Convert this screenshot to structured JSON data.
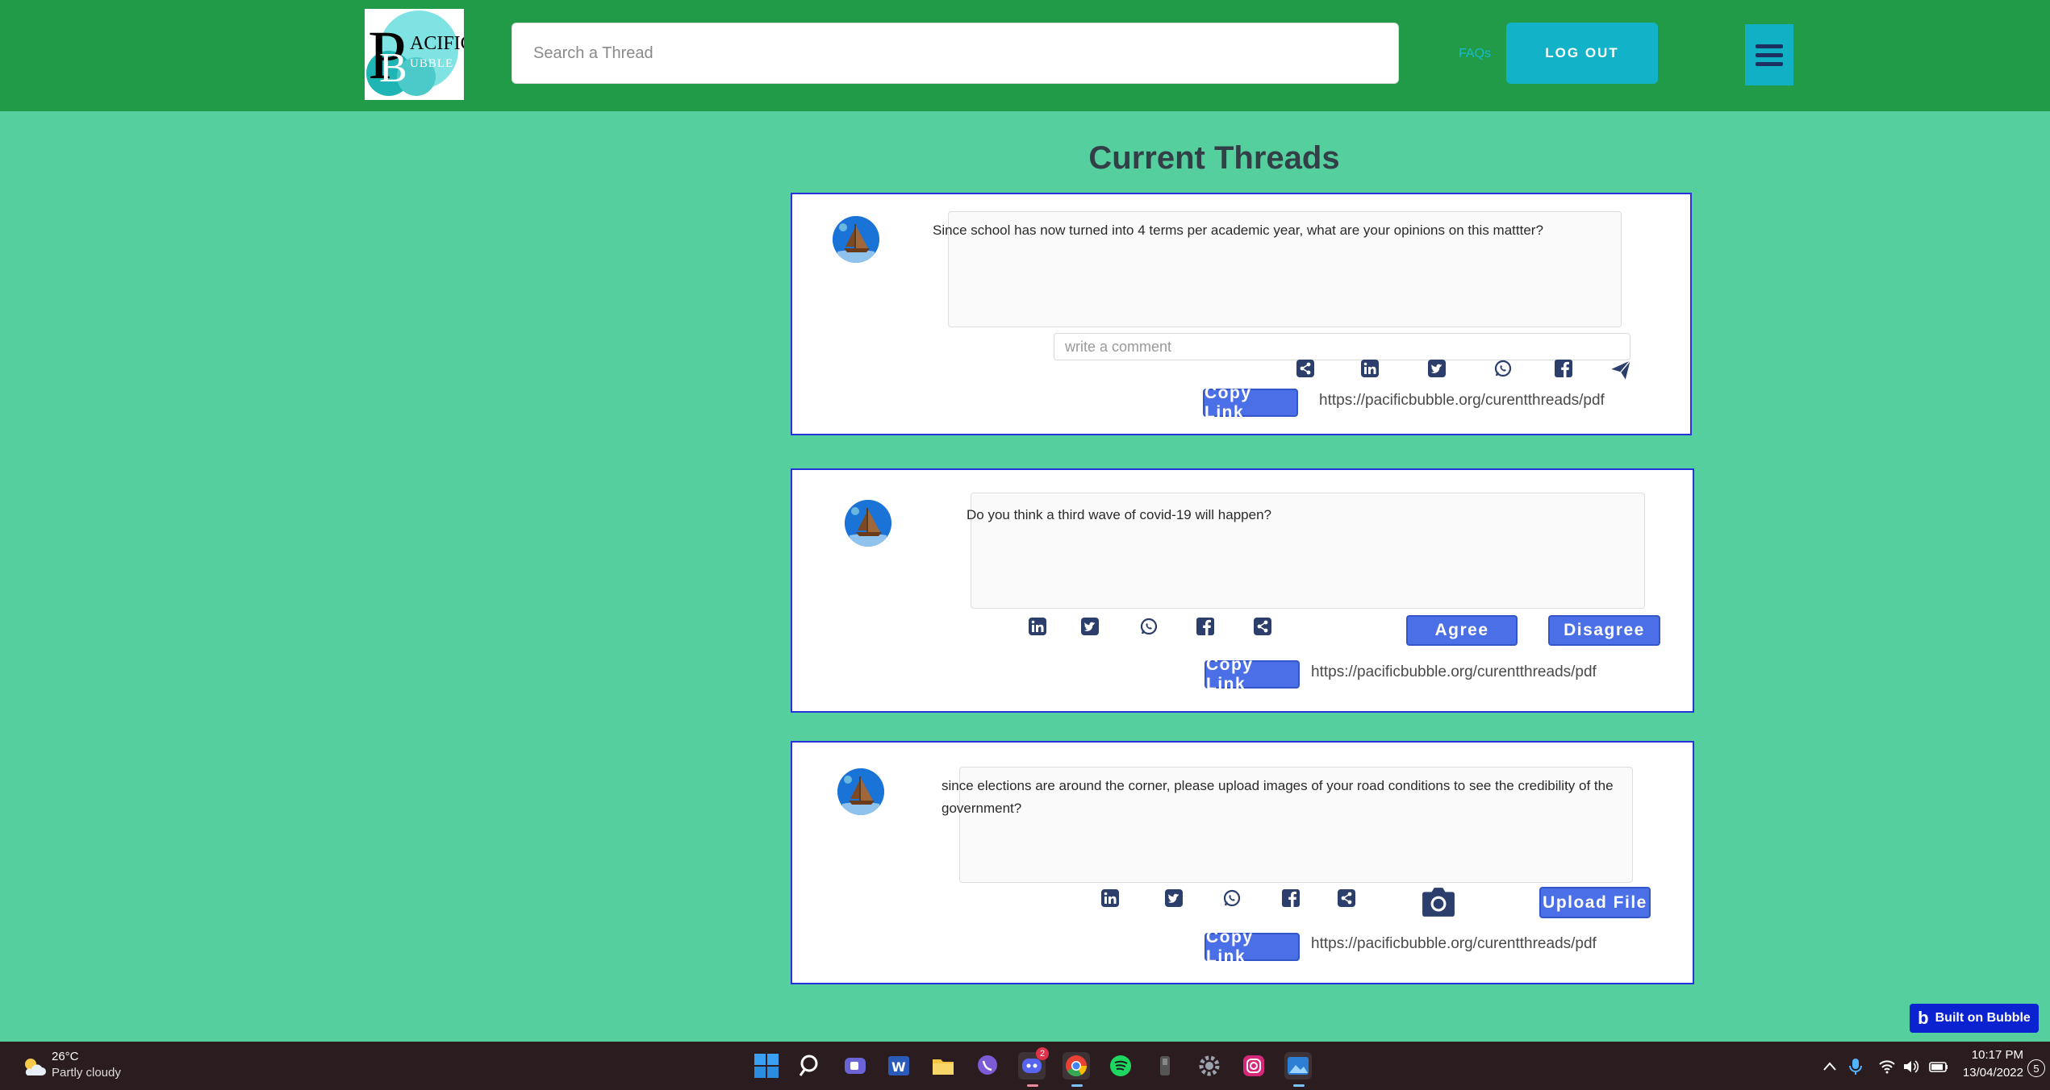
{
  "header": {
    "logo_alt": "Pacific Bubble",
    "logo_letters": {
      "p": "P",
      "b": "B",
      "acific": "ACIFIC",
      "ubble": "UBBLE"
    },
    "search_placeholder": "Search a Thread",
    "faq_label": "FAQs",
    "logout_label": "LOG OUT"
  },
  "page_title": "Current Threads",
  "threads": [
    {
      "question": "Since school has now turned into 4 terms per academic year, what are your opinions on this mattter?",
      "comment_placeholder": "write a comment",
      "copy_label": "Copy Link",
      "url": "https://pacificbubble.org/curentthreads/pdf"
    },
    {
      "question": "Do you think a third wave of covid-19 will happen?",
      "agree_label": "Agree",
      "disagree_label": "Disagree",
      "copy_label": "Copy Link",
      "url": "https://pacificbubble.org/curentthreads/pdf"
    },
    {
      "question": "since elections are around the corner, please upload images of your road conditions to see the credibility of the government?",
      "upload_label": "Upload File",
      "copy_label": "Copy Link",
      "url": "https://pacificbubble.org/curentthreads/pdf"
    }
  ],
  "built_on": {
    "label": "Built on Bubble",
    "logo": "b"
  },
  "taskbar": {
    "weather_temp": "26°C",
    "weather_desc": "Partly cloudy",
    "discord_badge": "2",
    "time": "10:17 PM",
    "date": "13/04/2022",
    "notification_count": "5"
  },
  "colors": {
    "page_bg": "#55cf9e",
    "header_bg": "#219b47",
    "accent_button": "#4b6fe6",
    "card_border": "#2733d9",
    "icon": "#2c3e6b"
  }
}
